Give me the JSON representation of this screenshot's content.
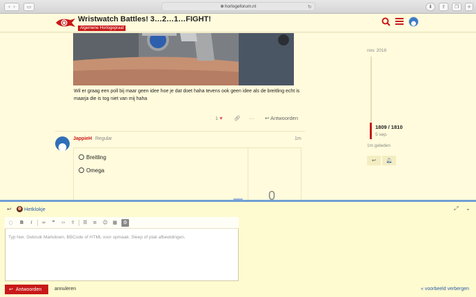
{
  "browser": {
    "url": "horlogeforum.nl",
    "back_icon": "chevron-left-icon",
    "forward_icon": "chevron-right-icon",
    "sidebar_icon": "sidebar-icon"
  },
  "header": {
    "topic_title": "Wristwatch Battles! 3…2…1…FIGHT!",
    "category": "Algemene Horlogepraat",
    "accent": "#c81919"
  },
  "post": {
    "text": "Wil er graag een poll bij maar geen idee hoe je dat doet haha tevens ook geen idee als de breitling echt is maarja die is tog niet van mij haha",
    "likes": "1",
    "reply_label": "Antwoorden"
  },
  "next_post": {
    "username": "JappieH",
    "user_title": "Regular",
    "time": "1m",
    "poll_options": [
      "Breitling",
      "Omega"
    ],
    "poll_count": "0"
  },
  "timeline": {
    "start_date": "nov. 2018",
    "position": "1809 / 1810",
    "position_date": "5 sep.",
    "last_activity": "1m geleden"
  },
  "composer": {
    "reply_to": "Hetklokje",
    "placeholder": "Typ hier. Gebruik Markdown, BBCode of HTML voor opmaak. Sleep of plak afbeeldingen.",
    "submit_label": "Antwoorden",
    "cancel_label": "annuleren",
    "hide_preview_label": "« voorbeeld verbergen"
  }
}
